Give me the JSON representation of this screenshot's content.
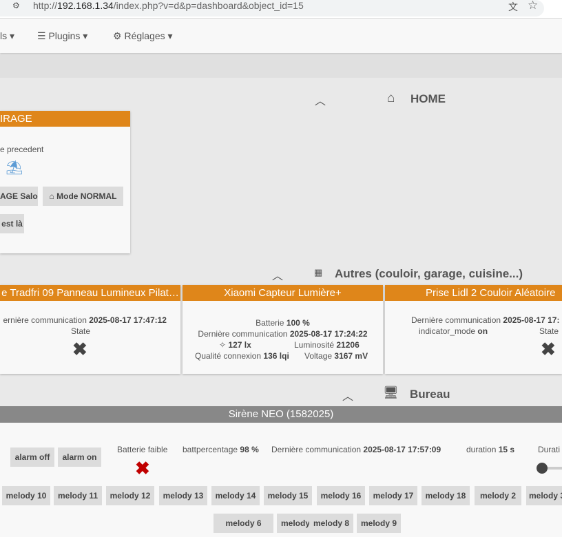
{
  "browser": {
    "url_host": "192.168.1.34",
    "url_path": "/index.php?v=d&p=dashboard&object_id=15",
    "prefix": "http://"
  },
  "nav": {
    "items": [
      {
        "label": "ls"
      },
      {
        "label": "Plugins"
      },
      {
        "label": "Réglages"
      }
    ]
  },
  "sections": {
    "home": "HOME",
    "autres": "Autres (couloir, garage, cuisine...)",
    "bureau": "Bureau"
  },
  "garage": {
    "title": "IRAGE",
    "prev": "e precedent",
    "btn1": "AGE Salon",
    "btn2": "Mode NORMAL",
    "btn3": "est là"
  },
  "tradfri": {
    "title": "e Tradfri 09 Panneau Lumineux Pilat…",
    "comm_label": "ernière communication",
    "comm": "2025-08-17 17:47:12",
    "state": "State"
  },
  "xiaomi": {
    "title": "Xiaomi Capteur Lumière+",
    "batt_label": "Batterie",
    "batt": "100 %",
    "comm_label": "Dernière communication",
    "comm": "2025-08-17 17:24:22",
    "lux": "127 lx",
    "lum_label": "Luminosité",
    "lum": "21206",
    "lqi_label": "Qualité connexion",
    "lqi": "136 lqi",
    "volt_label": "Voltage",
    "volt": "3167 mV"
  },
  "lidl": {
    "title": "Prise Lidl 2 Couloir Aléatoire",
    "comm_label": "Dernière communication",
    "comm": "2025-08-17 17:",
    "ind_label": "indicator_mode",
    "ind": "on",
    "state": "State"
  },
  "sirene": {
    "title": "Sirène NEO (1582025)",
    "alarm_off": "alarm off",
    "alarm_on": "alarm on",
    "batt_low": "Batterie faible",
    "battp_label": "battpercentage",
    "battp": "98 %",
    "comm_label": "Dernière communication",
    "comm": "2025-08-17 17:57:09",
    "dur_label": "duration",
    "dur": "15 s",
    "dur2": "Durati",
    "melodies": [
      "melody 10",
      "melody 11",
      "melody 12",
      "melody 13",
      "melody 14",
      "melody 15",
      "melody 16",
      "melody 17",
      "melody 18",
      "melody 2",
      "melody 3",
      "melody 6",
      "melody 7",
      "melody 8",
      "melody 9"
    ]
  },
  "colors": {
    "accent": "#df861a",
    "sirene_header": "#888888",
    "error": "#c00000"
  }
}
